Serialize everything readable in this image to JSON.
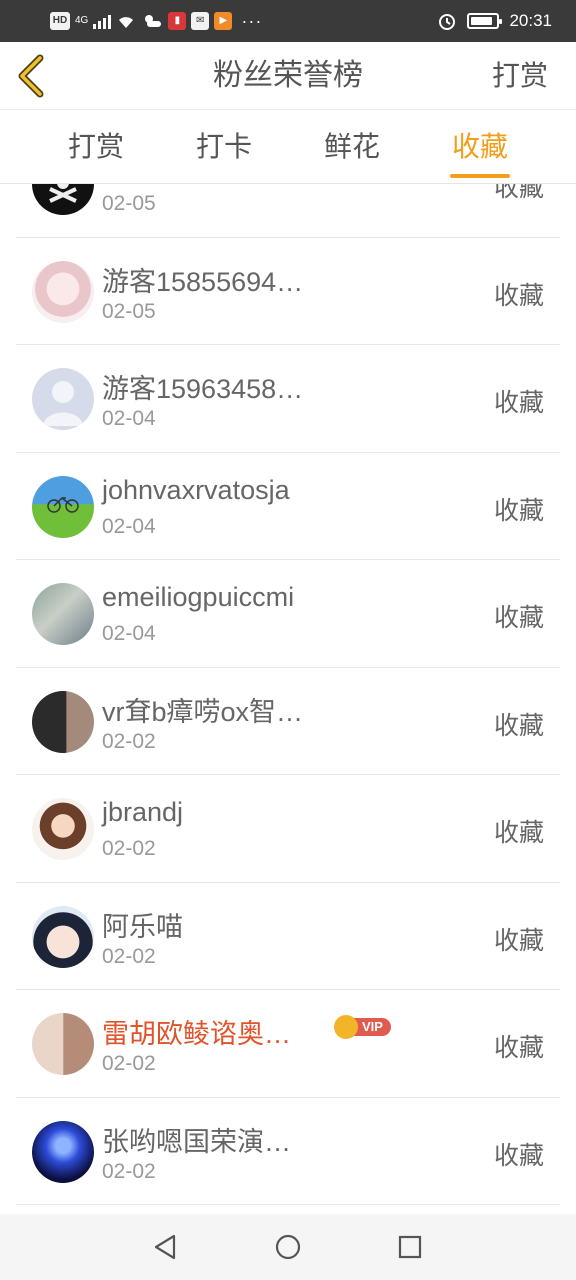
{
  "status_bar": {
    "hd": "HD",
    "net": "4G",
    "time": "20:31",
    "dots": "···",
    "icons": [
      "hd-icon",
      "signal-icon",
      "wifi-icon",
      "weather-icon",
      "app-notification-icon",
      "mail-icon",
      "video-icon",
      "alarm-icon",
      "battery-icon"
    ]
  },
  "header": {
    "back_icon": "chevron-left-icon",
    "title": "粉丝荣誉榜",
    "right_label": "打赏"
  },
  "tabs": [
    {
      "label": "打赏",
      "active": false
    },
    {
      "label": "打卡",
      "active": false
    },
    {
      "label": "鲜花",
      "active": false
    },
    {
      "label": "收藏",
      "active": true
    }
  ],
  "colors": {
    "accent": "#f29e1b",
    "vip_name": "#e0542b",
    "vip_badge": "#e05a4d"
  },
  "rows": [
    {
      "name": "",
      "date": "02-05",
      "action": "收藏",
      "vip": false,
      "avatar": "dark-emblem"
    },
    {
      "name": "游客15855694…",
      "date": "02-05",
      "action": "收藏",
      "vip": false,
      "avatar": "anime-girl"
    },
    {
      "name": "游客15963458…",
      "date": "02-04",
      "action": "收藏",
      "vip": false,
      "avatar": "default-person"
    },
    {
      "name": "johnvaxrvatosja",
      "date": "02-04",
      "action": "收藏",
      "vip": false,
      "avatar": "bicycle-field"
    },
    {
      "name": "emeiliogpuiccmi",
      "date": "02-04",
      "action": "收藏",
      "vip": false,
      "avatar": "girl-outdoor"
    },
    {
      "name": "vr耷b瘴唠ox智…",
      "date": "02-02",
      "action": "收藏",
      "vip": false,
      "avatar": "person-backpack"
    },
    {
      "name": "jbrandj",
      "date": "02-02",
      "action": "收藏",
      "vip": false,
      "avatar": "cartoon-hat"
    },
    {
      "name": "阿乐喵",
      "date": "02-02",
      "action": "收藏",
      "vip": false,
      "avatar": "anime-doll"
    },
    {
      "name": "雷胡欧鲮谘奥…",
      "date": "02-02",
      "action": "收藏",
      "vip": true,
      "vip_label": "VIP",
      "avatar": "couple-photo"
    },
    {
      "name": "张哟嗯国荣演…",
      "date": "02-02",
      "action": "收藏",
      "vip": false,
      "avatar": "concert-lights"
    }
  ],
  "bottom_nav": {
    "icons": [
      "back-triangle-icon",
      "home-circle-icon",
      "recent-square-icon"
    ]
  }
}
